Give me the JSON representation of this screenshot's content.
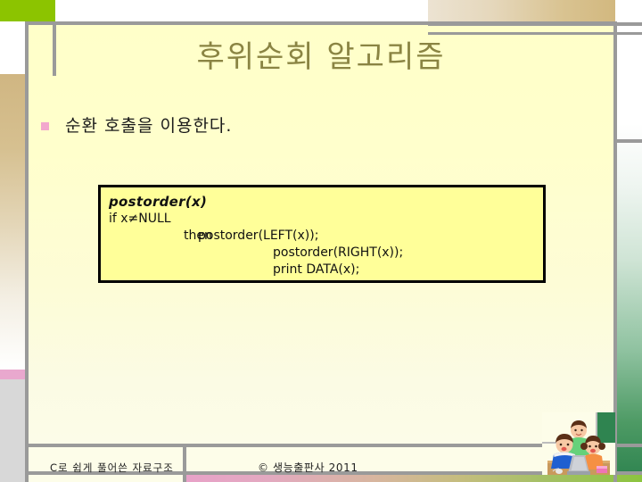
{
  "slide": {
    "title": "후위순회 알고리즘",
    "bullet": {
      "marker": "square-bullet",
      "text": "순환 호출을 이용한다."
    },
    "code_box": {
      "signature": "postorder(x)",
      "condition": "if x≠NULL",
      "then_keyword": "then",
      "statements": [
        "postorder(LEFT(x));",
        "postorder(RIGHT(x));",
        "print DATA(x);"
      ]
    },
    "footer": {
      "left": "C로 쉽게 풀어쓴 자료구조",
      "right": "© 생능출판사 2011"
    },
    "illustration": {
      "name": "three-children-at-computer"
    }
  },
  "colors": {
    "title_text": "#8a8443",
    "canvas_background": "#ffffcc",
    "code_box_background": "#ffff99",
    "code_box_border": "#000000",
    "bullet_marker": "#f2a8cd",
    "accent_green": "#8cc400",
    "accent_pink": "#e9a8ce",
    "accent_tan": "#d2b87f",
    "rule_gray": "#9a9a9a"
  }
}
